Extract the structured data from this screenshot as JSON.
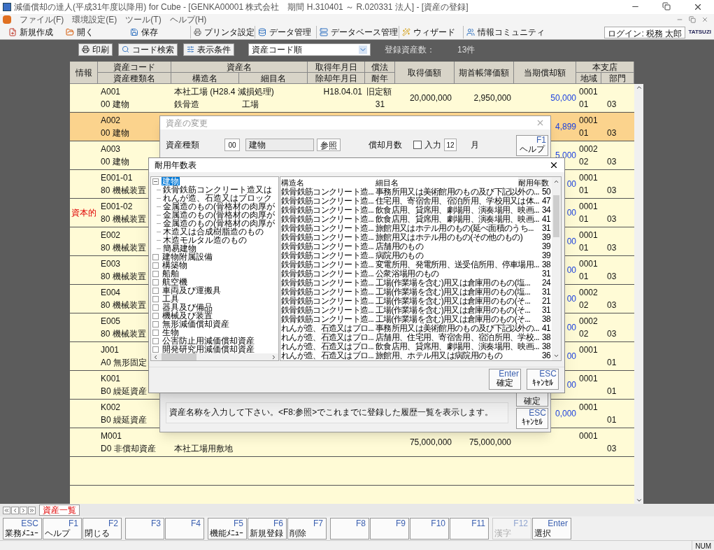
{
  "window": {
    "title": "減価償却の達人(平成31年度以降用) for Cube - [GENKA00001 株式会社　期間 H.310401 ～ R.020331 法人] - [資産の登録]"
  },
  "menu": [
    "ファイル(F)",
    "環境設定(E)",
    "ツール(T)",
    "ヘルプ(H)"
  ],
  "toolbar": [
    "新規作成",
    "開く",
    "保存",
    "プリンタ設定",
    "データ管理",
    "データベース管理",
    "ウィザード",
    "情報コミュニティ"
  ],
  "login": "ログイン: 税務 太郎",
  "logo": "TATSUZI",
  "list_toolbar": {
    "buttons": [
      "印刷",
      "コード検索",
      "表示条件"
    ],
    "sort": "資産コード順",
    "count_label": "登録資産数：",
    "count": "13件"
  },
  "table": {
    "header_top": [
      "情報",
      "資産コード",
      "資産名",
      "取得年月日",
      "償法",
      "取得価額",
      "期首帳簿価額",
      "当期償却額",
      "本支店"
    ],
    "header_bottom": [
      "資産種類名",
      "構造名",
      "細目名",
      "除却年月日",
      "耐年",
      "地域",
      "部門"
    ],
    "rows": [
      {
        "selected": false,
        "code": "A001",
        "type": "00 建物",
        "name": "本社工場 (H28.4 減損処理)",
        "structure": "鉄骨造",
        "detail": "工場",
        "acquired": "H18.04.01",
        "method": "旧定額",
        "life": "31",
        "cost": "20,000,000",
        "opening": "2,950,000",
        "depreciation": "50,000",
        "branch": "0001",
        "area": "01",
        "dept": "03"
      },
      {
        "selected": true,
        "code": "A002",
        "type": "00 建物",
        "depreciation": "4,899",
        "branch": "0001",
        "area": "01",
        "dept": "03"
      },
      {
        "selected": false,
        "code": "A003",
        "type": "00 建物",
        "depreciation": "5,000",
        "branch": "0002",
        "area": "02",
        "dept": "03"
      },
      {
        "selected": false,
        "code": "E001-01",
        "type": "80 機械装置",
        "depreciation": "00",
        "branch": "0001",
        "area": "01",
        "dept": "03"
      },
      {
        "selected": false,
        "code": "E001-02",
        "type": "80 機械装置",
        "info": "資本的",
        "depreciation": "00",
        "branch": "0001",
        "area": "01",
        "dept": "03"
      },
      {
        "selected": false,
        "code": "E002",
        "type": "80 機械装置",
        "depreciation": "00",
        "branch": "0001",
        "area": "01",
        "dept": "03"
      },
      {
        "selected": false,
        "code": "E003",
        "type": "80 機械装置",
        "depreciation": "00",
        "branch": "0001",
        "area": "01",
        "dept": "03"
      },
      {
        "selected": false,
        "code": "E004",
        "type": "80 機械装置",
        "depreciation": "00",
        "branch": "0002",
        "area": "02",
        "dept": "03"
      },
      {
        "selected": false,
        "code": "E005",
        "type": "80 機械装置",
        "depreciation": "00",
        "branch": "0002",
        "area": "02",
        "dept": "03"
      },
      {
        "selected": false,
        "code": "J001",
        "type": "A0 無形固定",
        "depreciation": "00",
        "branch": "0001",
        "dept": "01"
      },
      {
        "selected": false,
        "code": "K001",
        "type": "B0 繰延資産",
        "depreciation": "00",
        "branch": "0001",
        "dept": "01"
      },
      {
        "selected": false,
        "code": "K002",
        "type": "B0 繰延資産",
        "depreciation": "0,000",
        "branch": "0001",
        "dept": "01"
      },
      {
        "selected": false,
        "code": "M001",
        "type": "D0 非償却資産",
        "structure": "本社工場用敷地",
        "cost": "75,000,000",
        "opening": "75,000,000",
        "branch": "0001",
        "dept": "03"
      }
    ]
  },
  "edit_dialog": {
    "title": "資産の変更",
    "type_label": "資産種類",
    "type_code": "00",
    "type_name": "建物",
    "ref_button": "参照",
    "months_label": "償却月数",
    "input_label": "入力",
    "input_checked": false,
    "months": "12",
    "months_unit": "月",
    "help_button": {
      "key": "F1",
      "label": "ヘルプ"
    },
    "ok_button": "確定",
    "cancel_button": {
      "key": "ESC",
      "label": "ｷｬﾝｾﾙ"
    },
    "message": "資産名称を入力して下さい。<F8:参照>でこれまでに登録した履歴一覧を表示します。"
  },
  "life_dialog": {
    "title": "耐用年数表",
    "tree": [
      {
        "label": "建物",
        "selected": true,
        "expanded": true,
        "children": [
          {
            "label": "鉄骨鉄筋コンクリート造又は",
            "selected": false
          },
          {
            "label": "れんが造、石造又はブロック",
            "selected": false
          },
          {
            "label": "金属造のもの(骨格材の肉厚が",
            "selected": false
          },
          {
            "label": "金属造のもの(骨格材の肉厚が",
            "selected": false
          },
          {
            "label": "金属造のもの(骨格材の肉厚が",
            "selected": false
          },
          {
            "label": "木造又は合成樹脂造のもの",
            "selected": false
          },
          {
            "label": "木造モルタル造のもの",
            "selected": false
          },
          {
            "label": "簡易建物",
            "selected": false
          }
        ]
      },
      {
        "label": "建物附属設備",
        "selected": false,
        "expanded": false
      },
      {
        "label": "構築物",
        "selected": false,
        "expanded": false
      },
      {
        "label": "船舶",
        "selected": false,
        "expanded": false
      },
      {
        "label": "航空機",
        "selected": false,
        "expanded": false
      },
      {
        "label": "車両及び運搬具",
        "selected": false,
        "expanded": false
      },
      {
        "label": "工具",
        "selected": false,
        "expanded": false
      },
      {
        "label": "器具及び備品",
        "selected": false,
        "expanded": false
      },
      {
        "label": "機械及び装置",
        "selected": false,
        "expanded": false
      },
      {
        "label": "無形減価償却資産",
        "selected": false,
        "expanded": false
      },
      {
        "label": "生物",
        "selected": false,
        "expanded": false
      },
      {
        "label": "公害防止用減価償却資産",
        "selected": false,
        "expanded": false
      },
      {
        "label": "開発研究用減価償却資産",
        "selected": false,
        "expanded": false
      }
    ],
    "columns": [
      "構造名",
      "細目名",
      "耐用年数"
    ],
    "rows": [
      [
        "鉄骨鉄筋コンクリート造...",
        "事務所用又は美術館用のもの及び下記以外の...",
        "50"
      ],
      [
        "鉄骨鉄筋コンクリート造...",
        "住宅用、寄宿舎用、宿泊所用、学校用又は体...",
        "47"
      ],
      [
        "鉄骨鉄筋コンクリート造...",
        "飲食店用、貸席用、劇場用、演奏場用、映画...",
        "34"
      ],
      [
        "鉄骨鉄筋コンクリート造...",
        "飲食店用、貸席用、劇場用、演奏場用、映画...",
        "41"
      ],
      [
        "鉄骨鉄筋コンクリート造...",
        "旅館用又はホテル用のもの(延べ面積のうち...",
        "31"
      ],
      [
        "鉄骨鉄筋コンクリート造...",
        "旅館用又はホテル用のもの(その他のもの)",
        "39"
      ],
      [
        "鉄骨鉄筋コンクリート造...",
        "店舗用のもの",
        "39"
      ],
      [
        "鉄骨鉄筋コンクリート造...",
        "病院用のもの",
        "39"
      ],
      [
        "鉄骨鉄筋コンクリート造...",
        "変電所用、発電所用、送受信所用、停車場用...",
        "38"
      ],
      [
        "鉄骨鉄筋コンクリート造...",
        "公衆浴場用のもの",
        "31"
      ],
      [
        "鉄骨鉄筋コンクリート造...",
        "工場(作業場を含む)用又は倉庫用のもの(塩...",
        "24"
      ],
      [
        "鉄骨鉄筋コンクリート造...",
        "工場(作業場を含む)用又は倉庫用のもの(塩...",
        "31"
      ],
      [
        "鉄骨鉄筋コンクリート造...",
        "工場(作業場を含む)用又は倉庫用のもの(そ...",
        "21"
      ],
      [
        "鉄骨鉄筋コンクリート造...",
        "工場(作業場を含む)用又は倉庫用のもの(そ...",
        "31"
      ],
      [
        "鉄骨鉄筋コンクリート造...",
        "工場(作業場を含む)用又は倉庫用のもの(そ...",
        "38"
      ],
      [
        "れんが造、石造又はブロ...",
        "事務所用又は美術館用のもの及び下記以外の...",
        "41"
      ],
      [
        "れんが造、石造又はブロ...",
        "店舗用、住宅用、寄宿舎用、宿泊所用、学校...",
        "38"
      ],
      [
        "れんが造、石造又はブロ...",
        "飲食店用、貸席用、劇場用、演奏場用、映画...",
        "38"
      ],
      [
        "れんが造、石造又はブロ...",
        "旅館用、ホテル用又は病院用のもの",
        "36"
      ]
    ],
    "ok_button": {
      "key": "Enter",
      "label": "確定"
    },
    "cancel_button": {
      "key": "ESC",
      "label": "ｷｬﾝｾﾙ"
    }
  },
  "sheet_tab": "資産一覧",
  "function_keys": [
    {
      "key": "ESC",
      "label": "業務ﾒﾆｭｰ",
      "disabled": false
    },
    {
      "key": "F1",
      "label": "ヘルプ",
      "disabled": false
    },
    {
      "key": "F2",
      "label": "閉じる",
      "disabled": false
    },
    {
      "key": "F3",
      "disabled": false
    },
    {
      "key": "F4",
      "disabled": false
    },
    {
      "key": "F5",
      "label": "機能ﾒﾆｭｰ",
      "disabled": false
    },
    {
      "key": "F6",
      "label": "新規登録",
      "disabled": false
    },
    {
      "key": "F7",
      "label": "削除",
      "disabled": false
    },
    {
      "key": "F8",
      "disabled": false
    },
    {
      "key": "F9",
      "disabled": false
    },
    {
      "key": "F10",
      "disabled": false
    },
    {
      "key": "F11",
      "disabled": false
    },
    {
      "key": "F12",
      "label": "漢字",
      "disabled": true
    },
    {
      "key": "Enter",
      "label": "選択",
      "disabled": false
    }
  ],
  "status_bar": {
    "num": "NUM"
  }
}
